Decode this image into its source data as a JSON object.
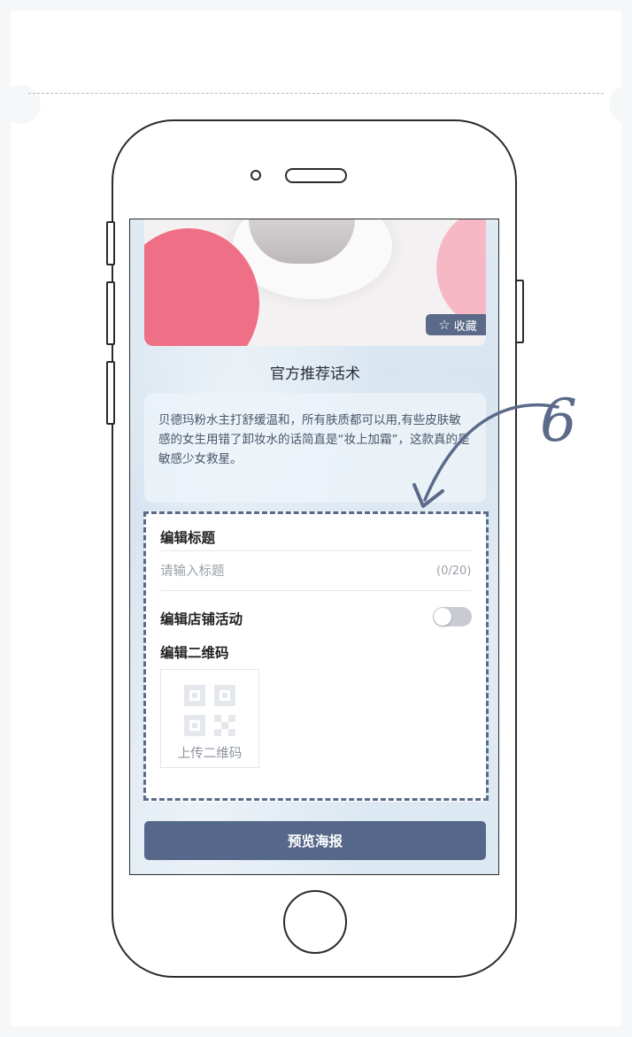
{
  "hero": {
    "favorite_label": "收藏"
  },
  "section_title": "官方推荐话术",
  "script_text": "贝德玛粉水主打舒缓温和，所有肤质都可以用,有些皮肤敏感的女生用错了卸妆水的话简直是“妆上加霜”，这款真的是敏感少女救星。",
  "form": {
    "title_label": "编辑标题",
    "title_placeholder": "请输入标题",
    "title_value": "",
    "title_counter": "(0/20)",
    "activity_label": "编辑店铺活动",
    "activity_enabled": false,
    "qr_label": "编辑二维码",
    "qr_upload_label": "上传二维码"
  },
  "preview_button": "预览海报",
  "annotation_number": "6",
  "colors": {
    "accent": "#56688a",
    "annotation": "#5a6a88",
    "hero_pink": "#ef6f86"
  }
}
